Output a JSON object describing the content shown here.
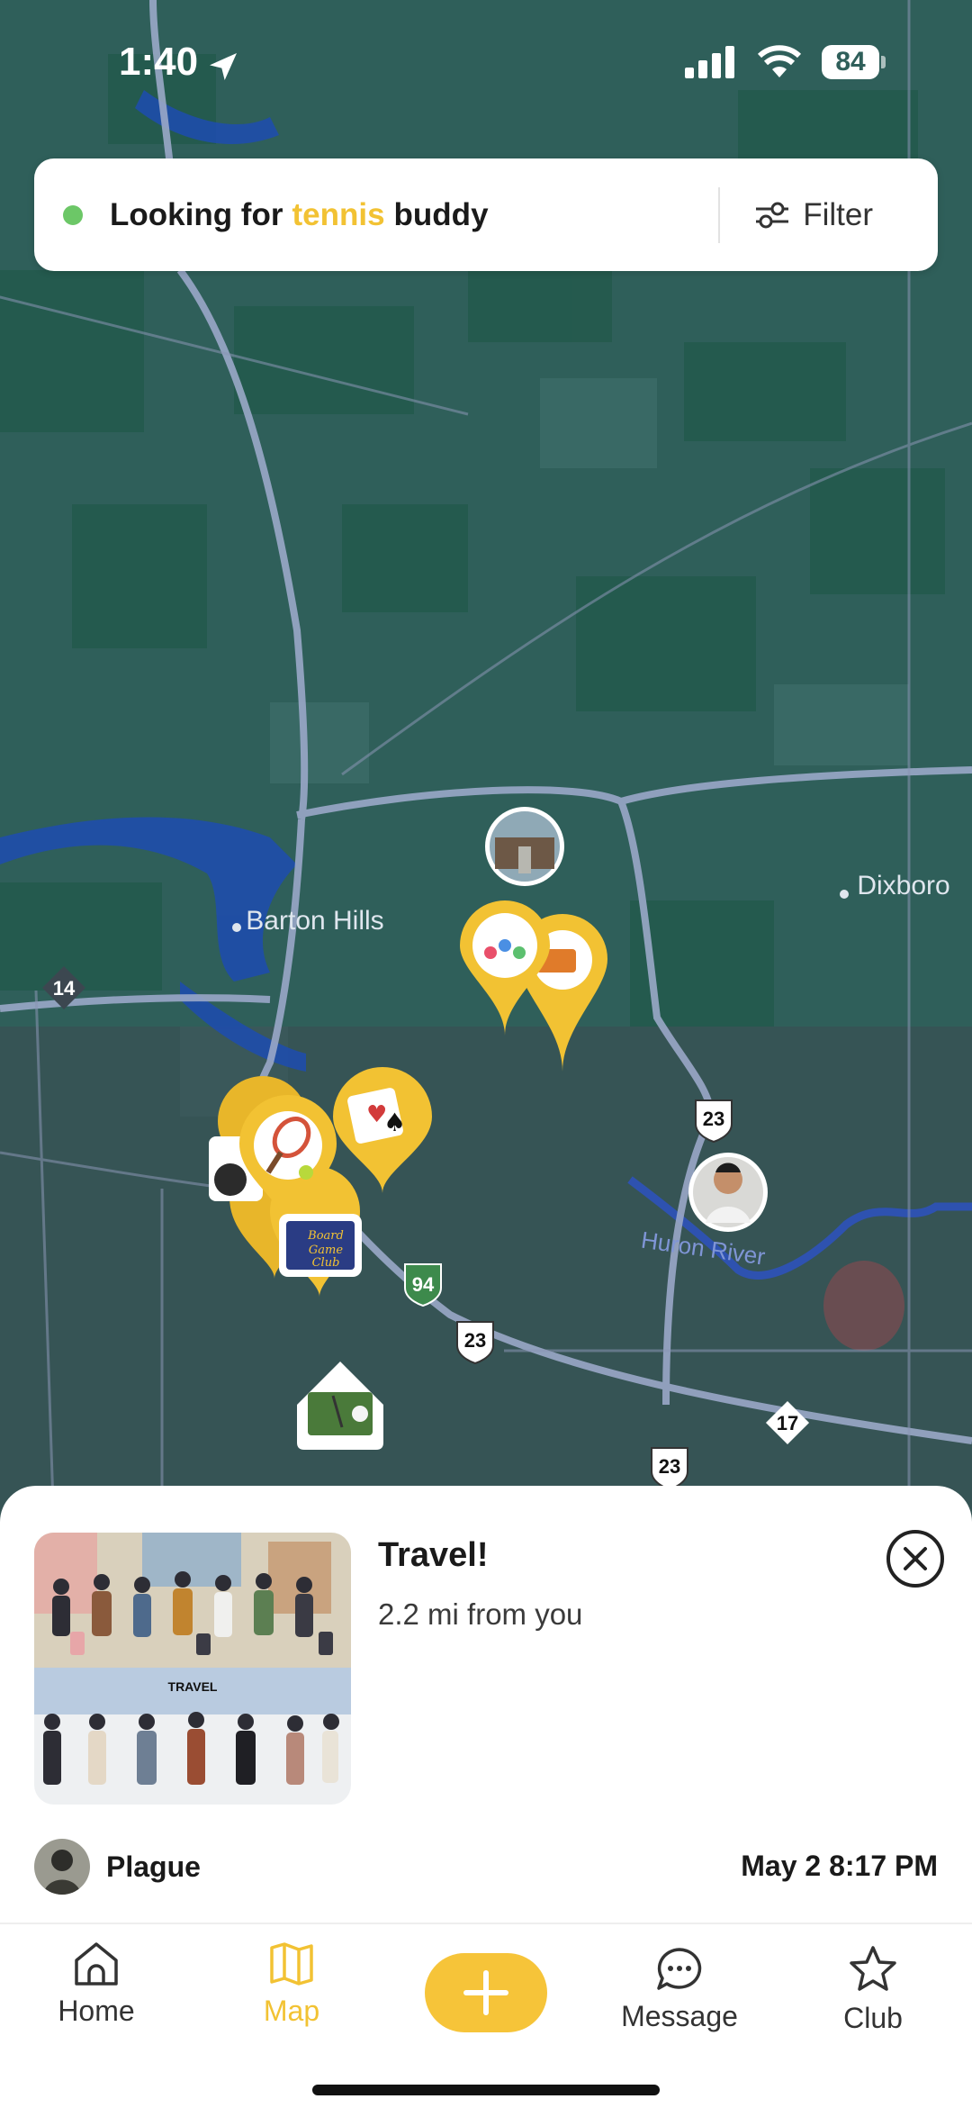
{
  "status_bar": {
    "time": "1:40",
    "battery": "84"
  },
  "search": {
    "prefix": "Looking for",
    "highlight": "tennis",
    "suffix": "buddy",
    "filter_label": "Filter"
  },
  "map": {
    "place_labels": [
      "Barton Hills",
      "Dixboro",
      "Huron River"
    ],
    "road_shields": [
      "14",
      "23",
      "94",
      "23",
      "17",
      "23"
    ]
  },
  "selected_event": {
    "title": "Travel!",
    "distance": "2.2 mi from you",
    "thumbnail_caption": "TRAVEL",
    "author": "Plague",
    "date": "May 2 8:17 PM",
    "close_icon": "close-circle-icon"
  },
  "tabbar": {
    "home": "Home",
    "map": "Map",
    "message": "Message",
    "club": "Club",
    "active": "map",
    "accent": "#f2c233"
  }
}
